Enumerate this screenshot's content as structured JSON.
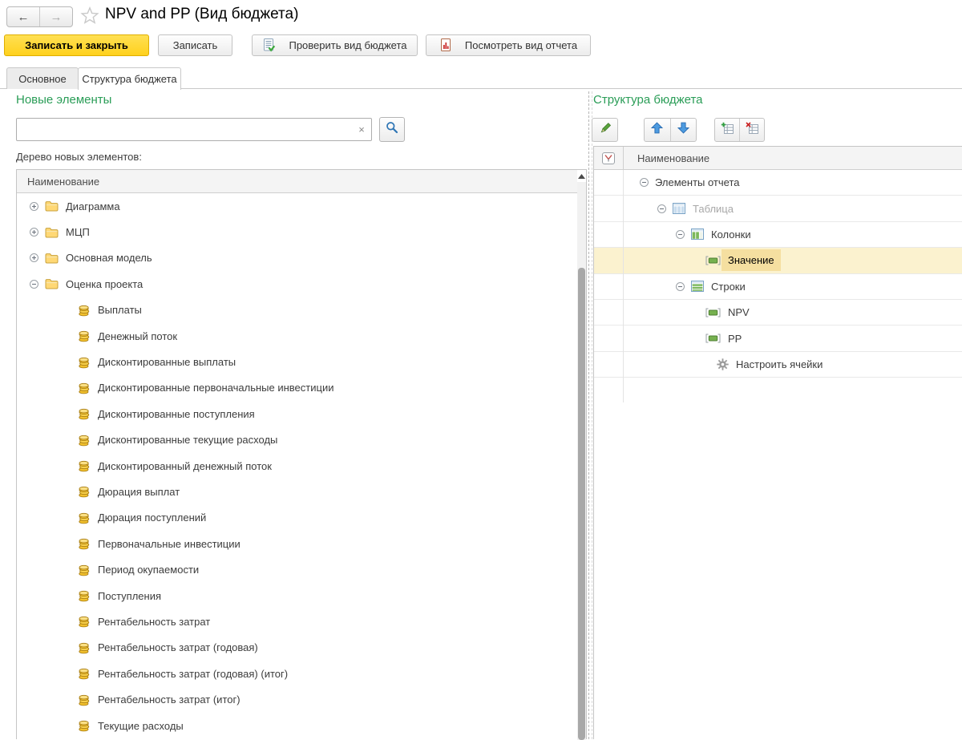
{
  "window": {
    "title": "NPV and PP (Вид бюджета)"
  },
  "toolbar": {
    "save_close_label": "Записать и закрыть",
    "save_label": "Записать",
    "check_label": "Проверить вид бюджета",
    "preview_label": "Посмотреть вид отчета"
  },
  "tabs": [
    {
      "label": "Основное",
      "active": false
    },
    {
      "label": "Структура бюджета",
      "active": true
    }
  ],
  "left_panel": {
    "title": "Новые элементы",
    "search": {
      "value": "",
      "clear_icon": "×",
      "search_icon": "magnifier"
    },
    "tree_label": "Дерево новых элементов:",
    "tree": {
      "column_header": "Наименование",
      "items": [
        {
          "label": "Диаграмма",
          "level": 1,
          "icon": "folder",
          "expander": "plus"
        },
        {
          "label": "МЦП",
          "level": 1,
          "icon": "folder",
          "expander": "plus"
        },
        {
          "label": "Основная модель",
          "level": 1,
          "icon": "folder",
          "expander": "plus"
        },
        {
          "label": "Оценка проекта",
          "level": 1,
          "icon": "folder",
          "expander": "minus"
        },
        {
          "label": "Выплаты",
          "level": 2,
          "icon": "coins"
        },
        {
          "label": "Денежный поток",
          "level": 2,
          "icon": "coins"
        },
        {
          "label": "Дисконтированные выплаты",
          "level": 2,
          "icon": "coins"
        },
        {
          "label": "Дисконтированные первоначальные инвестиции",
          "level": 2,
          "icon": "coins"
        },
        {
          "label": "Дисконтированные поступления",
          "level": 2,
          "icon": "coins"
        },
        {
          "label": "Дисконтированные текущие расходы",
          "level": 2,
          "icon": "coins"
        },
        {
          "label": "Дисконтированный денежный поток",
          "level": 2,
          "icon": "coins"
        },
        {
          "label": "Дюрация выплат",
          "level": 2,
          "icon": "coins"
        },
        {
          "label": "Дюрация поступлений",
          "level": 2,
          "icon": "coins"
        },
        {
          "label": "Первоначальные инвестиции",
          "level": 2,
          "icon": "coins"
        },
        {
          "label": "Период окупаемости",
          "level": 2,
          "icon": "coins"
        },
        {
          "label": "Поступления",
          "level": 2,
          "icon": "coins"
        },
        {
          "label": "Рентабельность затрат",
          "level": 2,
          "icon": "coins"
        },
        {
          "label": "Рентабельность затрат (годовая)",
          "level": 2,
          "icon": "coins"
        },
        {
          "label": "Рентабельность затрат (годовая) (итог)",
          "level": 2,
          "icon": "coins"
        },
        {
          "label": "Рентабельность затрат (итог)",
          "level": 2,
          "icon": "coins"
        },
        {
          "label": "Текущие расходы",
          "level": 2,
          "icon": "coins"
        }
      ]
    }
  },
  "right_panel": {
    "title": "Структура бюджета",
    "toolbar_icons": [
      "edit-pencil",
      "move-up-arrow",
      "move-down-arrow",
      "add-table-element",
      "remove-table-element"
    ],
    "tree": {
      "column_header": "Наименование",
      "corner_icon": "column-filter",
      "items": [
        {
          "label": "Элементы отчета",
          "level": 1,
          "expander": "minus"
        },
        {
          "label": "Таблица",
          "level": 2,
          "expander": "minus",
          "icon": "table",
          "muted": true
        },
        {
          "label": "Колонки",
          "level": 3,
          "expander": "minus",
          "icon": "table-columns"
        },
        {
          "label": "Значение",
          "level": 4,
          "icon": "field",
          "selected": true
        },
        {
          "label": "Строки",
          "level": 3,
          "expander": "minus",
          "icon": "table-rows"
        },
        {
          "label": "NPV",
          "level": 4,
          "icon": "field"
        },
        {
          "label": "PP",
          "level": 4,
          "icon": "field"
        },
        {
          "label": "Настроить ячейки",
          "level": 4,
          "icon": "gear"
        }
      ]
    }
  },
  "colors": {
    "accent_green": "#2a9d57",
    "primary_button_yellow": "#ffd42a",
    "selected_row": "#fbf2cf",
    "selected_cell": "#f5dfa0"
  }
}
